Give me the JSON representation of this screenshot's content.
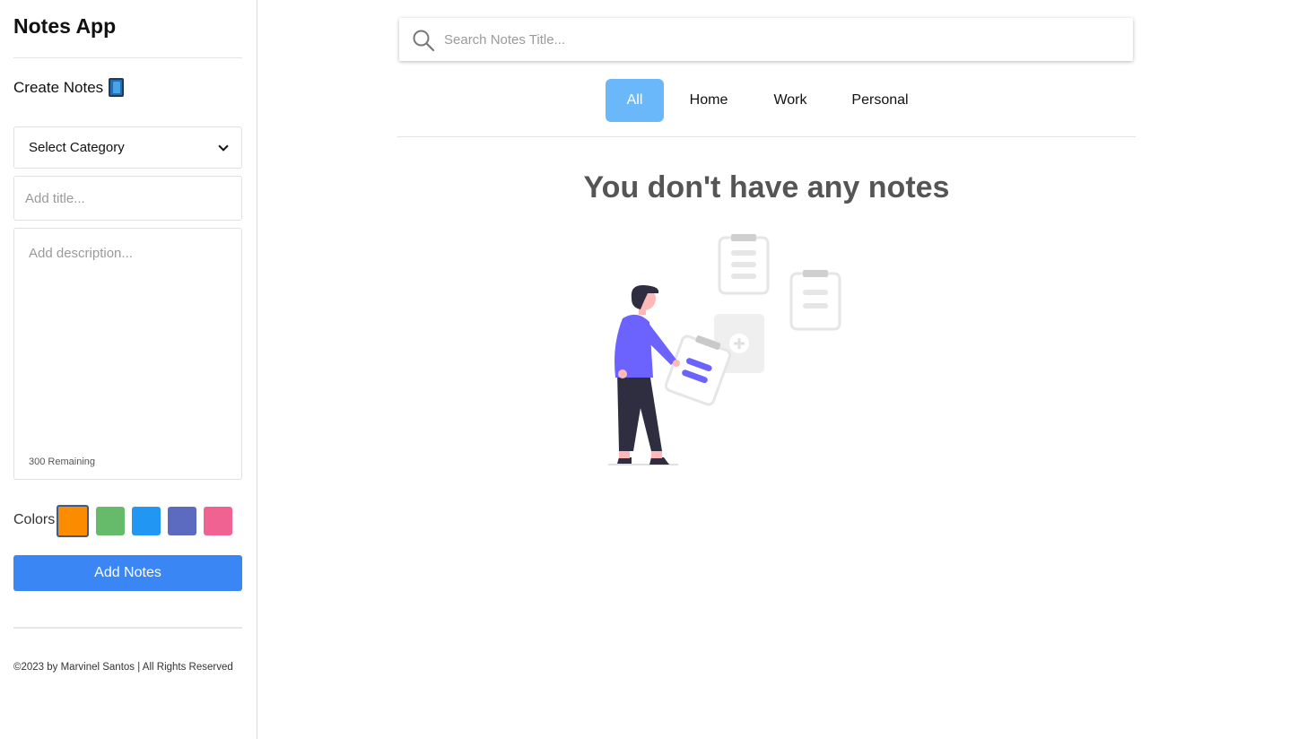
{
  "sidebar": {
    "app_title": "Notes App",
    "create_title": "Create Notes",
    "category_select": {
      "value": "Select Category"
    },
    "title_input": {
      "placeholder": "Add title..."
    },
    "description_input": {
      "placeholder": "Add description...",
      "remaining": "300 Remaining"
    },
    "colors_label": "Colors",
    "colors": [
      {
        "hex": "#fb8c00",
        "selected": true
      },
      {
        "hex": "#66bb6a",
        "selected": false
      },
      {
        "hex": "#2196f3",
        "selected": false
      },
      {
        "hex": "#5c6bc0",
        "selected": false
      },
      {
        "hex": "#f06292",
        "selected": false
      }
    ],
    "add_button": "Add Notes",
    "footer": "©2023 by Marvinel Santos | All Rights Reserved"
  },
  "main": {
    "search": {
      "placeholder": "Search Notes Title..."
    },
    "tabs": [
      {
        "label": "All",
        "active": true
      },
      {
        "label": "Home",
        "active": false
      },
      {
        "label": "Work",
        "active": false
      },
      {
        "label": "Personal",
        "active": false
      }
    ],
    "empty_message": "You don't have any notes"
  },
  "theme": {
    "accent": "#3b86f5",
    "active_tab": "#6ab8f9",
    "illustration_accent": "#6c63ff"
  }
}
